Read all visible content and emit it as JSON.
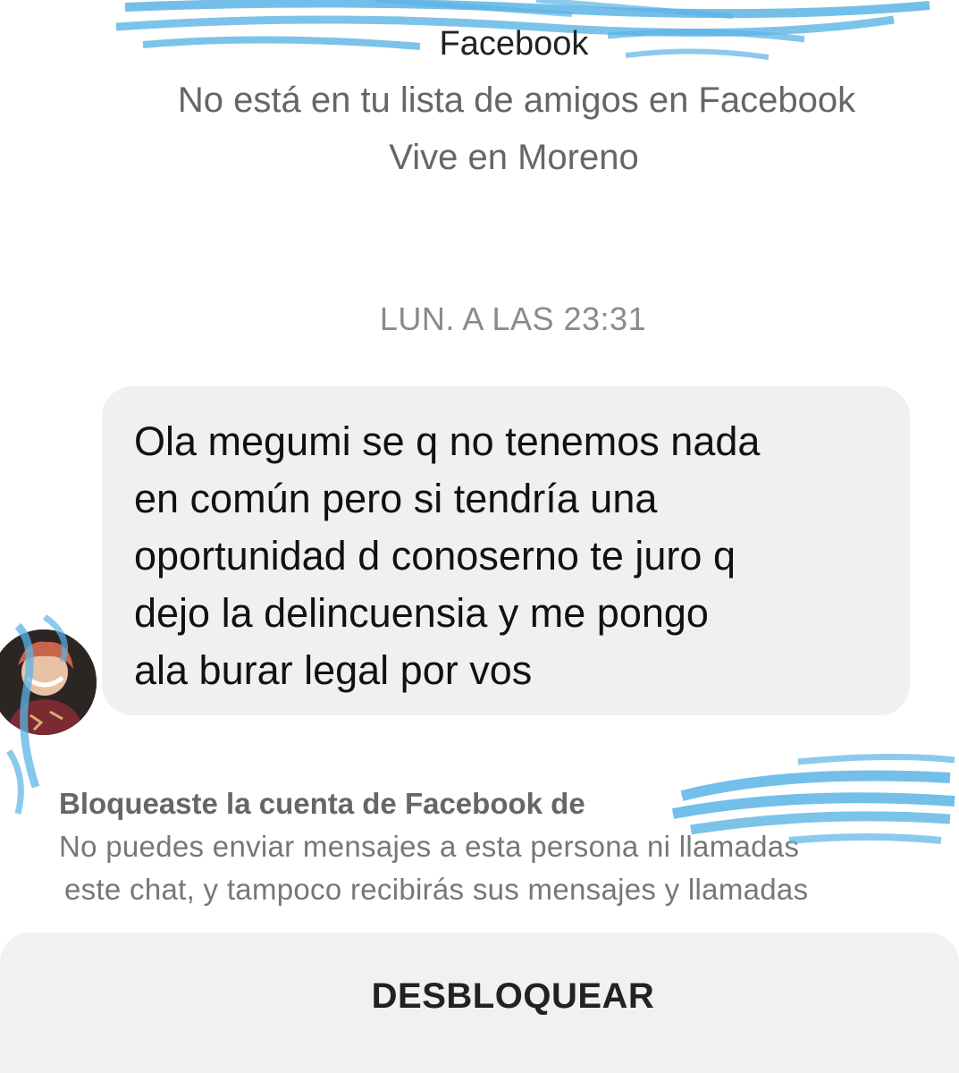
{
  "profile": {
    "source": "Facebook",
    "friend_status": "No está en tu lista de amigos en Facebook",
    "location": "Vive en Moreno"
  },
  "conversation": {
    "timestamp": "LUN. A LAS 23:31",
    "message": "Ola megumi se q no tenemos nada\nen común pero si tendría una\noportunidad d conoserno te juro q\ndejo la delincuensia y me pongo\nala burar legal por vos"
  },
  "block_notice": {
    "title": "Bloqueaste la cuenta de Facebook de",
    "line1": "No puedes enviar mensajes a esta persona ni llamadas",
    "line2": "este chat, y tampoco recibirás sus mensajes y llamadas"
  },
  "unblock": {
    "label": "DESBLOQUEAR"
  },
  "colors": {
    "redaction": "#5bb4e5",
    "bubble": "#f0f0f0",
    "muted_text": "#666666"
  },
  "icons": {
    "avatar": "avatar-image"
  }
}
